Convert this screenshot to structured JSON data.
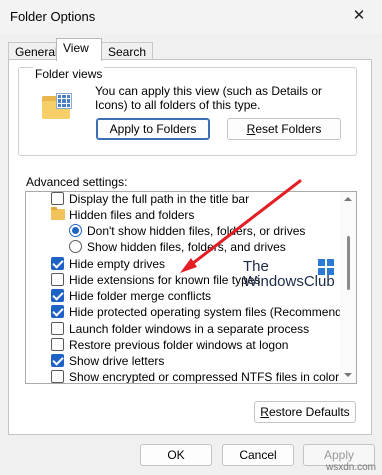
{
  "window": {
    "title": "Folder Options",
    "close_glyph": "✕"
  },
  "tabs": [
    {
      "label": "General",
      "active": false
    },
    {
      "label": "View",
      "active": true
    },
    {
      "label": "Search",
      "active": false
    }
  ],
  "folder_views": {
    "label": "Folder views",
    "description": "You can apply this view (such as Details or Icons) to all folders of this type.",
    "apply_button": "Apply to Folders",
    "reset_button": "Reset Folders"
  },
  "advanced": {
    "label": "Advanced settings:",
    "items": [
      {
        "type": "checkbox",
        "checked": false,
        "label": "Display the full path in the title bar",
        "indent": 0
      },
      {
        "type": "folder",
        "label": "Hidden files and folders",
        "indent": 0
      },
      {
        "type": "radio",
        "checked": true,
        "label": "Don't show hidden files, folders, or drives",
        "indent": 1
      },
      {
        "type": "radio",
        "checked": false,
        "label": "Show hidden files, folders, and drives",
        "indent": 1
      },
      {
        "type": "checkbox",
        "checked": true,
        "label": "Hide empty drives",
        "indent": 0
      },
      {
        "type": "checkbox",
        "checked": false,
        "label": "Hide extensions for known file types",
        "indent": 0
      },
      {
        "type": "checkbox",
        "checked": true,
        "label": "Hide folder merge conflicts",
        "indent": 0
      },
      {
        "type": "checkbox",
        "checked": true,
        "label": "Hide protected operating system files (Recommended)",
        "indent": 0
      },
      {
        "type": "checkbox",
        "checked": false,
        "label": "Launch folder windows in a separate process",
        "indent": 0
      },
      {
        "type": "checkbox",
        "checked": false,
        "label": "Restore previous folder windows at logon",
        "indent": 0
      },
      {
        "type": "checkbox",
        "checked": true,
        "label": "Show drive letters",
        "indent": 0
      },
      {
        "type": "checkbox",
        "checked": false,
        "label": "Show encrypted or compressed NTFS files in color",
        "indent": 0
      }
    ],
    "restore_button": "Restore Defaults"
  },
  "watermark": {
    "line1": "The",
    "line2": "WindowsClub"
  },
  "footer": {
    "ok": "OK",
    "cancel": "Cancel",
    "apply": "Apply",
    "site": "wsxdn.com"
  },
  "colors": {
    "accent": "#1e63c4",
    "arrow": "#e31e24"
  }
}
